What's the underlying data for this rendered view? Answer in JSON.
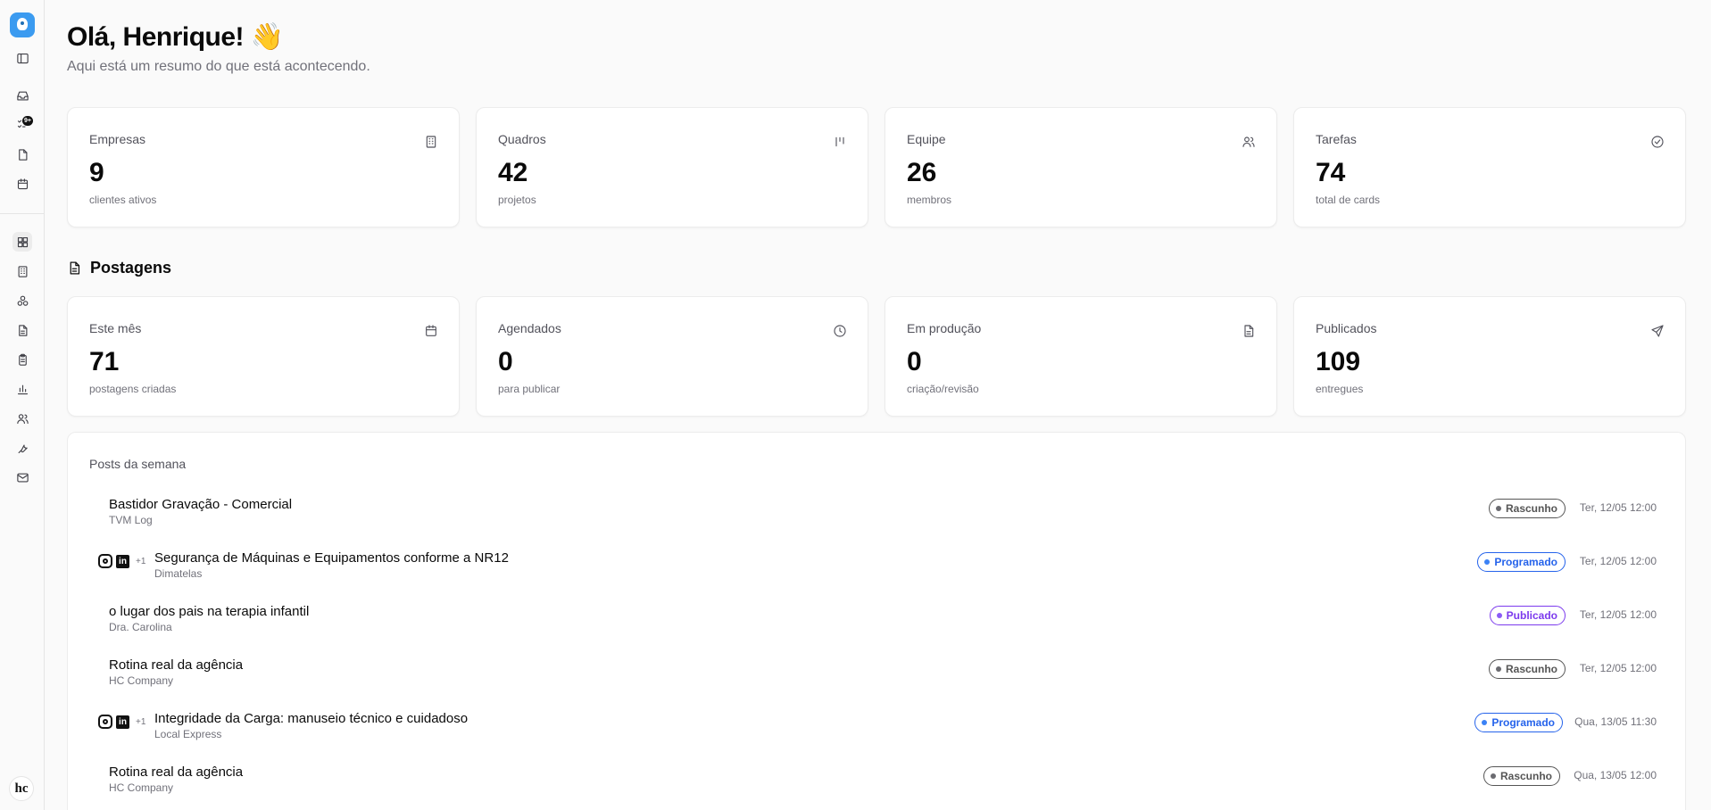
{
  "sidebar": {
    "icons": [
      "logo",
      "panel-left-icon",
      "inbox-icon",
      "tasks-icon",
      "file-icon",
      "calendar-icon",
      "dashboard-icon",
      "building-icon",
      "apps-icon",
      "document-icon",
      "clipboard-icon",
      "chart-icon",
      "users-icon",
      "wrench-icon",
      "mail-icon"
    ],
    "tasks_badge": "9+",
    "avatar_text": "hc"
  },
  "header": {
    "greeting": "Olá, Henrique! 👋",
    "subtitle": "Aqui está um resumo do que está acontecendo."
  },
  "stats": [
    {
      "label": "Empresas",
      "value": "9",
      "sub": "clientes ativos",
      "icon": "building-icon"
    },
    {
      "label": "Quadros",
      "value": "42",
      "sub": "projetos",
      "icon": "kanban-icon"
    },
    {
      "label": "Equipe",
      "value": "26",
      "sub": "membros",
      "icon": "users-icon"
    },
    {
      "label": "Tarefas",
      "value": "74",
      "sub": "total de cards",
      "icon": "check-circle-icon"
    }
  ],
  "postagens": {
    "title": "Postagens",
    "stats": [
      {
        "label": "Este mês",
        "value": "71",
        "sub": "postagens criadas",
        "icon": "calendar-icon"
      },
      {
        "label": "Agendados",
        "value": "0",
        "sub": "para publicar",
        "icon": "clock-icon"
      },
      {
        "label": "Em produção",
        "value": "0",
        "sub": "criação/revisão",
        "icon": "file-text-icon"
      },
      {
        "label": "Publicados",
        "value": "109",
        "sub": "entregues",
        "icon": "send-icon"
      }
    ]
  },
  "week": {
    "title": "Posts da semana",
    "posts": [
      {
        "title": "Bastidor Gravação - Comercial",
        "client": "TVM Log",
        "status": "Rascunho",
        "date": "Ter, 12/05 12:00",
        "networks": false
      },
      {
        "title": "Segurança de Máquinas e Equipamentos conforme a NR12",
        "client": "Dimatelas",
        "status": "Programado",
        "date": "Ter, 12/05 12:00",
        "networks": true,
        "more": "+1"
      },
      {
        "title": "o lugar dos pais na terapia infantil",
        "client": "Dra. Carolina",
        "status": "Publicado",
        "date": "Ter, 12/05 12:00",
        "networks": false
      },
      {
        "title": "Rotina real da agência",
        "client": "HC Company",
        "status": "Rascunho",
        "date": "Ter, 12/05 12:00",
        "networks": false
      },
      {
        "title": "Integridade da Carga: manuseio técnico e cuidadoso",
        "client": "Local Express",
        "status": "Programado",
        "date": "Qua, 13/05 11:30",
        "networks": true,
        "more": "+1"
      },
      {
        "title": "Rotina real da agência",
        "client": "HC Company",
        "status": "Rascunho",
        "date": "Qua, 13/05 12:00",
        "networks": false
      }
    ]
  },
  "colors": {
    "rascunho": "#6b6b70",
    "programado": "#3b82f6",
    "publicado": "#8b5cf6",
    "logo": "#3b9bf0"
  }
}
